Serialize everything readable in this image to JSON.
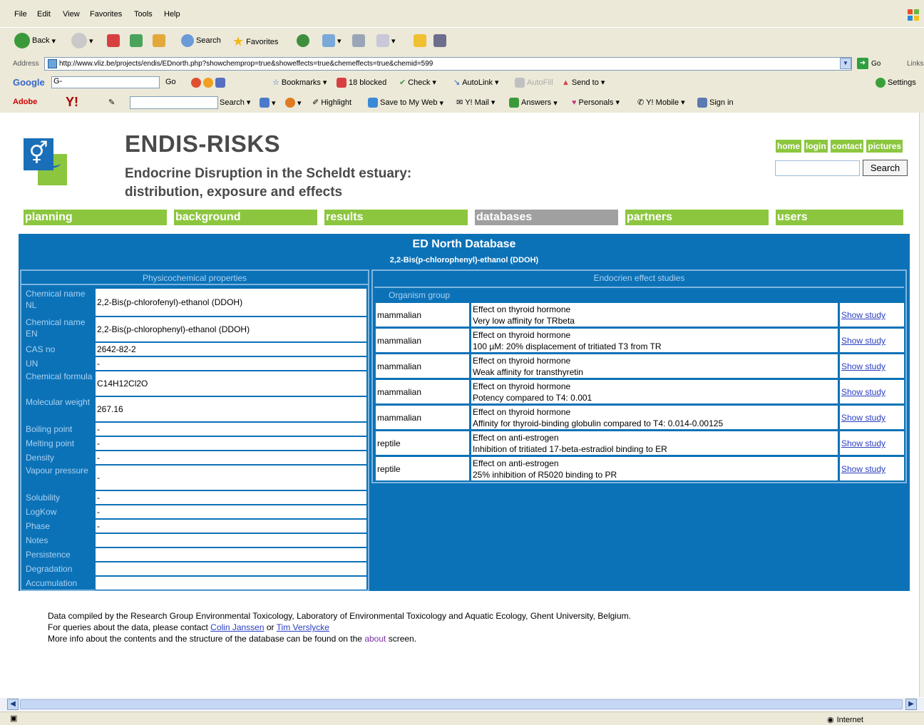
{
  "browser": {
    "menu": [
      "File",
      "Edit",
      "View",
      "Favorites",
      "Tools",
      "Help"
    ],
    "toolbar": {
      "back": "Back",
      "search": "Search",
      "favorites": "Favorites"
    },
    "address": {
      "label": "Address",
      "url": "http://www.vliz.be/projects/endis/EDnorth.php?showchemprop=true&showeffects=true&chemeffects=true&chemid=599",
      "go": "Go",
      "links": "Links"
    },
    "google_bar": {
      "brand": "Google",
      "input": "G-",
      "go": "Go",
      "bookmarks": "Bookmarks",
      "blocked": "18 blocked",
      "check": "Check",
      "autolink": "AutoLink",
      "autofill": "AutoFill",
      "send_to": "Send to",
      "settings": "Settings"
    },
    "yahoo_bar": {
      "adobe": "Adobe",
      "yahoo": "Y!",
      "search": "Search",
      "highlight": "Highlight",
      "save_web": "Save to My Web",
      "mail": "Y! Mail",
      "answers": "Answers",
      "personals": "Personals",
      "mobile": "Y! Mobile",
      "signin": "Sign in"
    },
    "status": {
      "zone": "Internet"
    }
  },
  "site": {
    "title": "ENDIS-RISKS",
    "subtitle": "Endocrine Disruption in the Scheldt estuary: distribution, exposure and effects",
    "quicklinks": [
      "home",
      "login",
      "contact",
      "pictures"
    ],
    "search_button": "Search",
    "nav": [
      "planning",
      "background",
      "results",
      "databases",
      "partners",
      "users"
    ],
    "active_nav": "databases"
  },
  "database": {
    "title": "ED North Database",
    "compound": "2,2-Bis(p-chlorophenyl)-ethanol (DDOH)",
    "physico_header": "Physicochemical properties",
    "properties": [
      {
        "label": "Chemical name NL",
        "value": "2,2-Bis(p-chlorofenyl)-ethanol (DDOH)"
      },
      {
        "label": "Chemical name EN",
        "value": "2,2-Bis(p-chlorophenyl)-ethanol (DDOH)"
      },
      {
        "label": "CAS no",
        "value": "2642-82-2"
      },
      {
        "label": "UN",
        "value": "-"
      },
      {
        "label": "Chemical formula",
        "value": "C14H12Cl2O"
      },
      {
        "label": "Molecular weight",
        "value": "267.16"
      },
      {
        "label": "Boiling point",
        "value": "-"
      },
      {
        "label": "Melting point",
        "value": "-"
      },
      {
        "label": "Density",
        "value": "-"
      },
      {
        "label": "Vapour pressure",
        "value": "-"
      },
      {
        "label": "Solubility",
        "value": "-"
      },
      {
        "label": "LogKow",
        "value": "-"
      },
      {
        "label": "Phase",
        "value": "-"
      },
      {
        "label": "Notes",
        "value": ""
      },
      {
        "label": "Persistence",
        "value": ""
      },
      {
        "label": "Degradation",
        "value": ""
      },
      {
        "label": "Accumulation",
        "value": ""
      }
    ],
    "effects_header": "Endocrien effect studies",
    "effects_col": "Organism group",
    "effects": [
      {
        "organism": "mammalian",
        "effect": "Effect on thyroid hormone",
        "detail": "Very low affinity for TRbeta",
        "link": "Show study"
      },
      {
        "organism": "mammalian",
        "effect": "Effect on thyroid hormone",
        "detail": "100 µM: 20% displacement of tritiated T3 from TR",
        "link": "Show study"
      },
      {
        "organism": "mammalian",
        "effect": "Effect on thyroid hormone",
        "detail": "Weak affinity for transthyretin",
        "link": "Show study"
      },
      {
        "organism": "mammalian",
        "effect": "Effect on thyroid hormone",
        "detail": "Potency compared to T4: 0.001",
        "link": "Show study"
      },
      {
        "organism": "mammalian",
        "effect": "Effect on thyroid hormone",
        "detail": "Affinity for thyroid-binding globulin compared to T4: 0.014-0.00125",
        "link": "Show study"
      },
      {
        "organism": "reptile",
        "effect": "Effect on anti-estrogen",
        "detail": "Inhibition of tritiated 17-beta-estradiol binding to ER",
        "link": "Show study"
      },
      {
        "organism": "reptile",
        "effect": "Effect on anti-estrogen",
        "detail": "25% inhibition of R5020 binding to PR",
        "link": "Show study"
      }
    ]
  },
  "footer": {
    "line1": "Data compiled by the Research Group Environmental Toxicology, Laboratory of Environmental Toxicology and Aquatic Ecology, Ghent University, Belgium.",
    "line2_pre": "For queries about the data, please contact",
    "contact1": "Colin Janssen",
    "line2_mid": "or",
    "contact2": "Tim Verslycke",
    "line3_pre": "More info about the contents and the structure of the database can be found on the",
    "about": "about",
    "line3_post": "screen."
  },
  "colors": {
    "brand_green": "#8cc63f",
    "panel_blue": "#0c72b7",
    "active_nav": "#a0a0a0"
  }
}
